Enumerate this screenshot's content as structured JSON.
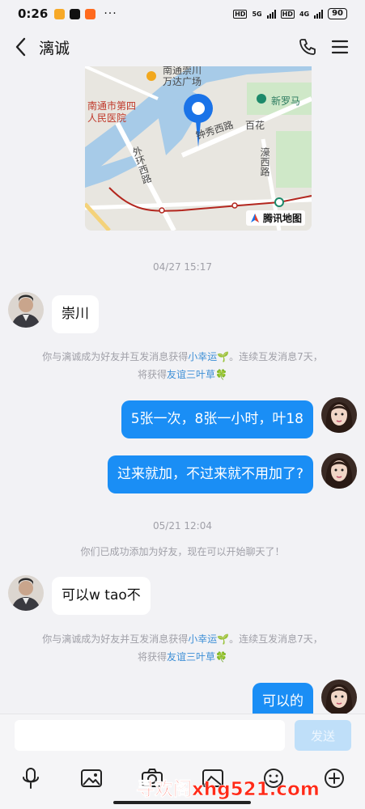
{
  "status_bar": {
    "time": "0:26",
    "dots": "···",
    "hd1": "HD",
    "net1": "5G",
    "hd2": "HD",
    "net2": "4G",
    "battery": "90"
  },
  "header": {
    "contact_name": "漓诚",
    "icons": [
      "back-chevron-icon",
      "phone-icon",
      "menu-icon"
    ]
  },
  "map": {
    "labels": {
      "top": "南通崇川",
      "plaza": "万达广场",
      "hospital_line1": "南通市第四",
      "hospital_line2": "人民医院",
      "mall": "新罗马",
      "road1": "钟秀西路",
      "baihua": "百花",
      "road2": "濠西路",
      "road3": "外环西路"
    },
    "provider": "腾讯地图"
  },
  "messages": [
    {
      "type": "time",
      "text": "04/27 15:17"
    },
    {
      "type": "received",
      "text": "崇川"
    },
    {
      "type": "system",
      "line1_prefix": "你与漓诚成为好友并互发消息获得",
      "line1_link": "小幸运",
      "line1_suffix": "🌱。连续互发消息7天，",
      "line2_prefix": "将获得",
      "line2_link": "友谊三叶草",
      "line2_suffix": "🍀"
    },
    {
      "type": "sent",
      "text": "5张一次，8张一小时，叶18"
    },
    {
      "type": "sent",
      "text": "过来就加，不过来就不用加了?"
    },
    {
      "type": "time",
      "text": "05/21 12:04"
    },
    {
      "type": "system_plain",
      "text": "你们已成功添加为好友，现在可以开始聊天了！"
    },
    {
      "type": "received",
      "text": "可以w tao不"
    },
    {
      "type": "system",
      "line1_prefix": "你与漓诚成为好友并互发消息获得",
      "line1_link": "小幸运",
      "line1_suffix": "🌱。连续互发消息7天，",
      "line2_prefix": "将获得",
      "line2_link": "友谊三叶草",
      "line2_suffix": "🍀"
    },
    {
      "type": "sent",
      "text": "可以的"
    }
  ],
  "input": {
    "value": "",
    "placeholder": "",
    "send_label": "发送"
  },
  "toolbar": {
    "icons": [
      "microphone-icon",
      "image-icon",
      "camera-icon",
      "gallery-icon",
      "emoji-icon",
      "plus-icon"
    ]
  },
  "watermark": "寻欢阁xhg521.com",
  "colors": {
    "sent_bubble": "#1a8ef5",
    "received_bubble": "#ffffff",
    "background": "#f2f2f5",
    "link": "#3d8fd6",
    "watermark": "#ff2a18"
  }
}
